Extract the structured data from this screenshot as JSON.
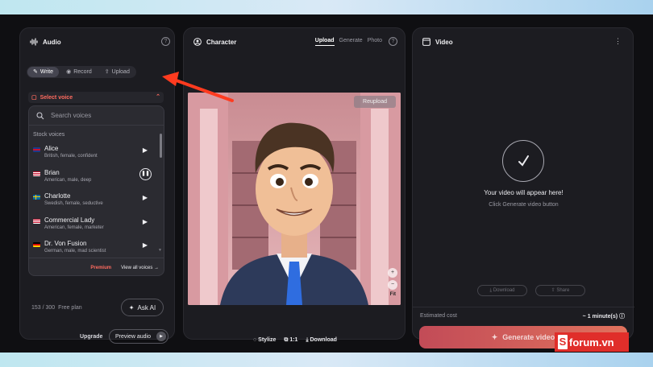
{
  "audio": {
    "title": "Audio",
    "tabs": [
      {
        "label": "Write"
      },
      {
        "label": "Record"
      },
      {
        "label": "Upload"
      }
    ],
    "select_voice_label": "Select voice",
    "search_placeholder": "Search voices",
    "section_label": "Stock voices",
    "voices": [
      {
        "name": "Alice",
        "desc": "British, female, confident",
        "flag": "uk"
      },
      {
        "name": "Brian",
        "desc": "American, male, deep",
        "flag": "us"
      },
      {
        "name": "Charlotte",
        "desc": "Swedish, female, seductive",
        "flag": "se"
      },
      {
        "name": "Commercial Lady",
        "desc": "American, female, marketer",
        "flag": "us"
      },
      {
        "name": "Dr. Von Fusion",
        "desc": "German, male, mad scientist",
        "flag": "de"
      }
    ],
    "premium_label": "Premium",
    "view_all_label": "View all voices",
    "usage": "153 / 300",
    "plan": "Free plan",
    "ask_ai_label": "Ask AI",
    "upgrade_label": "Upgrade",
    "preview_label": "Preview audio"
  },
  "character": {
    "title": "Character",
    "tabs": [
      {
        "label": "Upload",
        "active": true
      },
      {
        "label": "Generate"
      },
      {
        "label": "Photo"
      }
    ],
    "reupload_label": "Reupload",
    "fit_label": "Fit",
    "footer": {
      "stylize": "Stylize",
      "ratio": "1:1",
      "download": "Download"
    }
  },
  "video": {
    "title": "Video",
    "message": "Your video will appear here!",
    "sub": "Click Generate video button",
    "download_label": "Download",
    "share_label": "Share",
    "estimated_cost_label": "Estimated cost",
    "estimated_cost_value": "~ 1 minute(s)",
    "generate_label": "Generate video"
  },
  "watermark": {
    "text": "forum.vn",
    "badge": "S"
  },
  "colors": {
    "accent": "#ff6b5f",
    "generate_start": "#c24b57",
    "generate_end": "#e0725d",
    "arrow": "#ff3b1f"
  }
}
